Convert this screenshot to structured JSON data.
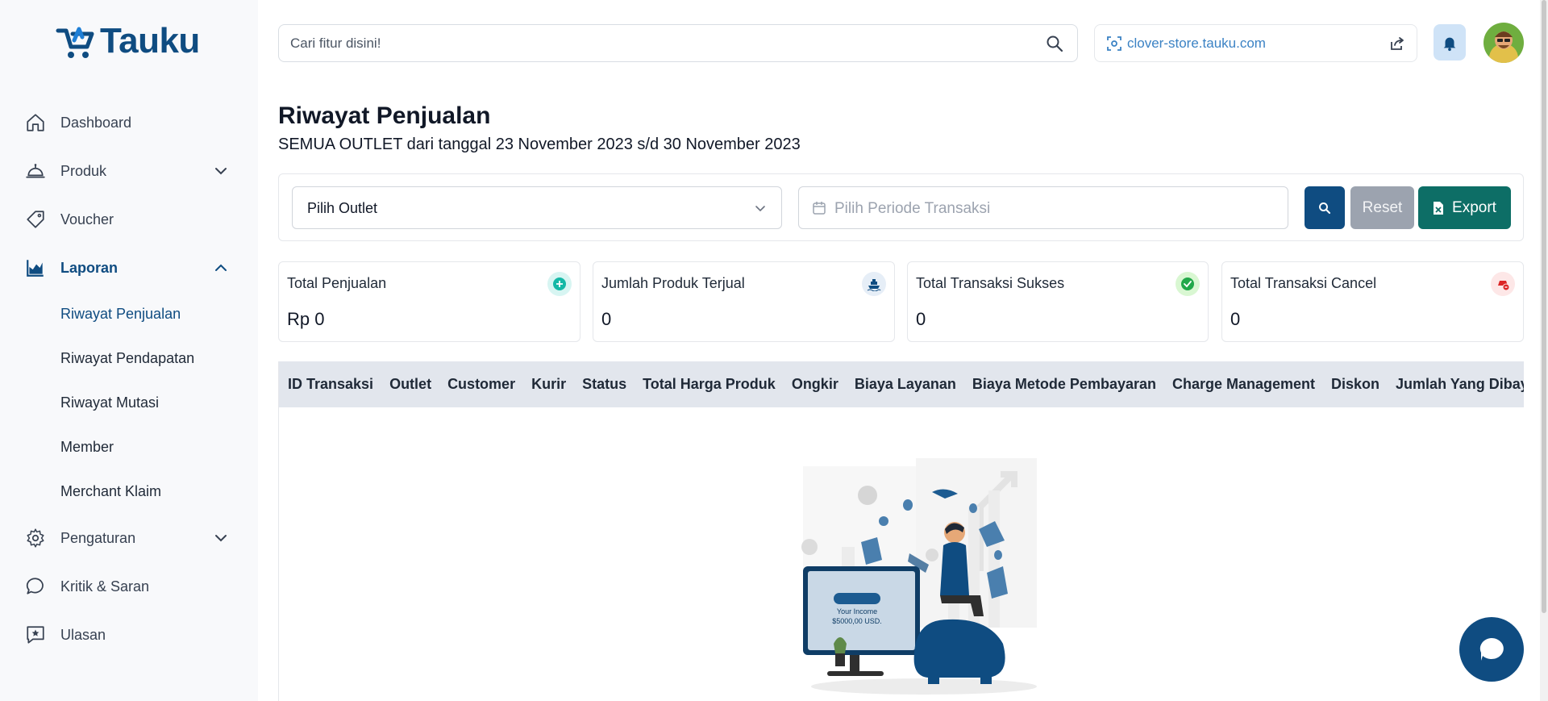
{
  "brand": {
    "name": "Tauku",
    "color": "#0f4c81"
  },
  "sidebar": {
    "items": [
      {
        "label": "Dashboard",
        "icon": "home-icon"
      },
      {
        "label": "Produk",
        "icon": "cloche-icon",
        "expandable": true
      },
      {
        "label": "Voucher",
        "icon": "tag-icon"
      },
      {
        "label": "Laporan",
        "icon": "chart-icon",
        "expandable": true,
        "expanded": true,
        "active": true
      },
      {
        "label": "Pengaturan",
        "icon": "gear-icon",
        "expandable": true
      },
      {
        "label": "Kritik & Saran",
        "icon": "chat-bubble-icon"
      },
      {
        "label": "Ulasan",
        "icon": "star-review-icon"
      }
    ],
    "laporan_sub": [
      {
        "label": "Riwayat Penjualan",
        "active": true
      },
      {
        "label": "Riwayat Pendapatan"
      },
      {
        "label": "Riwayat Mutasi"
      },
      {
        "label": "Member"
      },
      {
        "label": "Merchant Klaim"
      }
    ]
  },
  "topbar": {
    "search_placeholder": "Cari fitur disini!",
    "store_url": "clover-store.tauku.com"
  },
  "page": {
    "title": "Riwayat Penjualan",
    "subtitle": "SEMUA OUTLET dari tanggal 23 November 2023 s/d 30 November 2023"
  },
  "filter": {
    "outlet_value": "Pilih Outlet",
    "period_placeholder": "Pilih Periode Transaksi",
    "reset_label": "Reset",
    "export_label": "Export"
  },
  "stats": [
    {
      "title": "Total Penjualan",
      "value": "Rp 0",
      "icon": "plus-circle-icon",
      "badge_bg": "#d7f5f2",
      "icon_color": "#14b8a6"
    },
    {
      "title": "Jumlah Produk Terjual",
      "value": "0",
      "icon": "ship-icon",
      "badge_bg": "#e6eef7",
      "icon_color": "#0f4c81"
    },
    {
      "title": "Total Transaksi Sukses",
      "value": "0",
      "icon": "check-circle-icon",
      "badge_bg": "#d9f7d2",
      "icon_color": "#22a84a"
    },
    {
      "title": "Total Transaksi Cancel",
      "value": "0",
      "icon": "cancel-icon",
      "badge_bg": "#fde7e7",
      "icon_color": "#dc2626"
    }
  ],
  "table": {
    "columns": [
      "ID Transaksi",
      "Outlet",
      "Customer",
      "Kurir",
      "Status",
      "Total Harga Produk",
      "Ongkir",
      "Biaya Layanan",
      "Biaya Metode Pembayaran",
      "Charge Management",
      "Diskon",
      "Jumlah Yang Dibayar"
    ],
    "empty_illustration": {
      "line1": "Your Income",
      "line2": "$5000,00 USD."
    }
  }
}
